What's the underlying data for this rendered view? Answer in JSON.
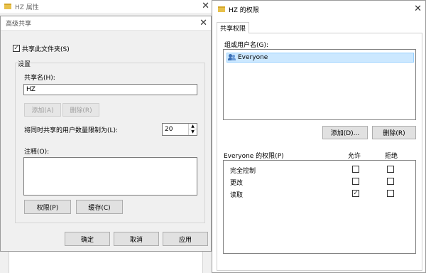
{
  "bg_window": {
    "title": "HZ 属性"
  },
  "advanced_dialog": {
    "title": "高级共享",
    "share_checkbox_label": "共享此文件夹(S)",
    "share_checked": true,
    "settings_group_label": "设置",
    "share_name_label": "共享名(H):",
    "share_name_value": "HZ",
    "add_label": "添加(A)",
    "remove_label": "删除(R)",
    "user_limit_label": "将同时共享的用户数量限制为(L):",
    "user_limit_value": "20",
    "comment_label": "注释(O):",
    "comment_value": "",
    "permissions_button": "权限(P)",
    "caching_button": "缓存(C)",
    "ok": "确定",
    "cancel": "取消",
    "apply": "应用"
  },
  "perm_dialog": {
    "title": "HZ 的权限",
    "tab": "共享权限",
    "group_label": "组或用户名(G):",
    "users": [
      "Everyone"
    ],
    "add_button": "添加(D)...",
    "remove_button": "删除(R)",
    "perm_header": "Everyone 的权限(P)",
    "allow_header": "允许",
    "deny_header": "拒绝",
    "permissions": [
      {
        "name": "完全控制",
        "allow": false,
        "deny": false
      },
      {
        "name": "更改",
        "allow": false,
        "deny": false
      },
      {
        "name": "读取",
        "allow": true,
        "deny": false
      }
    ]
  },
  "colors": {
    "selection": "#cce8ff",
    "selection_border": "#99d1ff",
    "button_face": "#e1e1e1",
    "user_icon": "#3a6fb5"
  }
}
